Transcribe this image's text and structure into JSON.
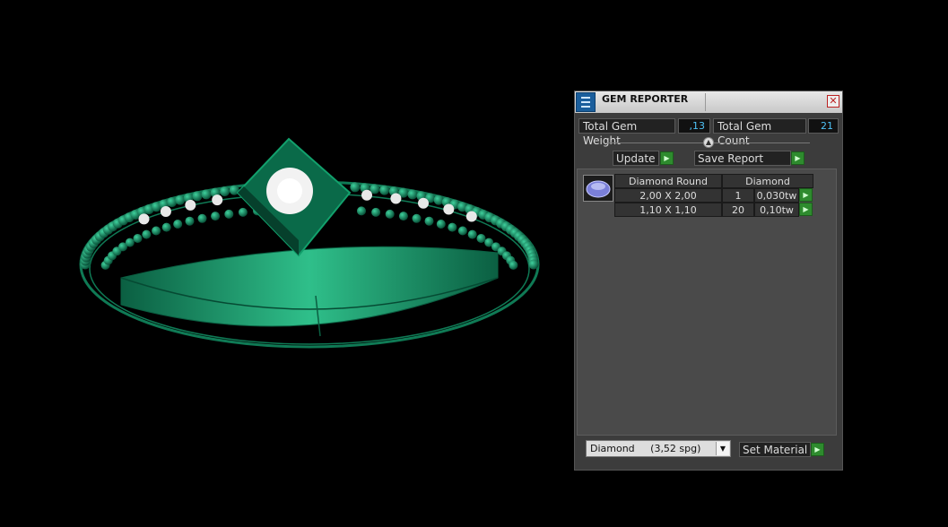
{
  "panel": {
    "title": "GEM REPORTER",
    "total_gem_weight_label": "Total Gem Weight",
    "total_gem_weight_value": ",13",
    "total_gem_count_label": "Total Gem Count",
    "total_gem_count_value": "21",
    "update_label": "Update",
    "save_report_label": "Save Report",
    "table": {
      "headers": [
        "Diamond Round",
        "Diamond"
      ],
      "rows": [
        {
          "size": "2,00 X 2,00",
          "count": "1",
          "weight": "0,030tw"
        },
        {
          "size": "1,10 X 1,10",
          "count": "20",
          "weight": "0,10tw"
        }
      ]
    },
    "material_select_value": "Diamond     (3,52 spg)",
    "set_material_label": "Set Material"
  },
  "colors": {
    "ring_green": "#0f7a55",
    "accent_value": "#4fc3f7",
    "button_green": "#2e8b2e"
  },
  "icons": {
    "app": "gem-reporter-icon",
    "close": "close-icon",
    "play": "play-arrow-icon",
    "dropdown": "chevron-down-icon",
    "gem": "round-gem-icon"
  }
}
